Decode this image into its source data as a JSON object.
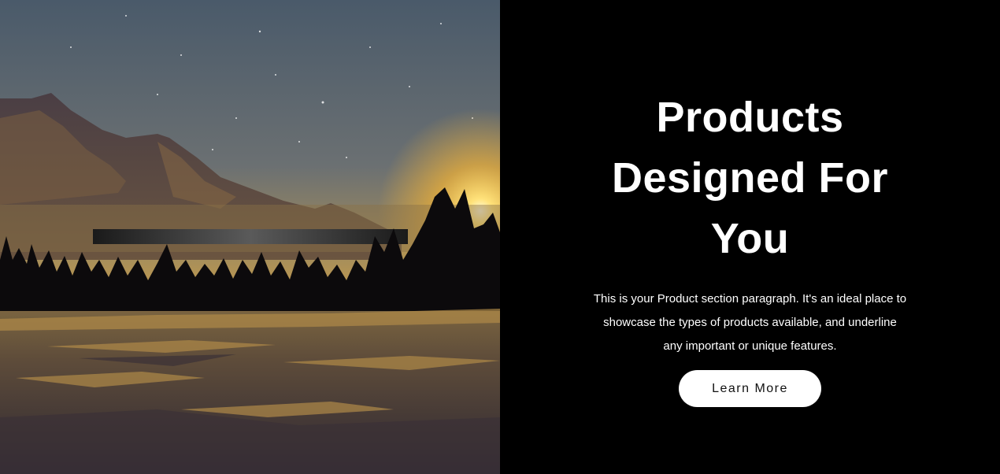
{
  "hero": {
    "title_line1": "Products",
    "title_line2": "Designed For",
    "title_line3": "You",
    "paragraph": "This is your Product section paragraph. It's an ideal place to showcase the types of products available, and underline any important or unique features.",
    "button_label": "Learn More"
  },
  "colors": {
    "background": "#000000",
    "button_bg": "#ffffff",
    "text": "#ffffff"
  },
  "image": {
    "subject": "sunset-mountain-forest-illustration"
  }
}
